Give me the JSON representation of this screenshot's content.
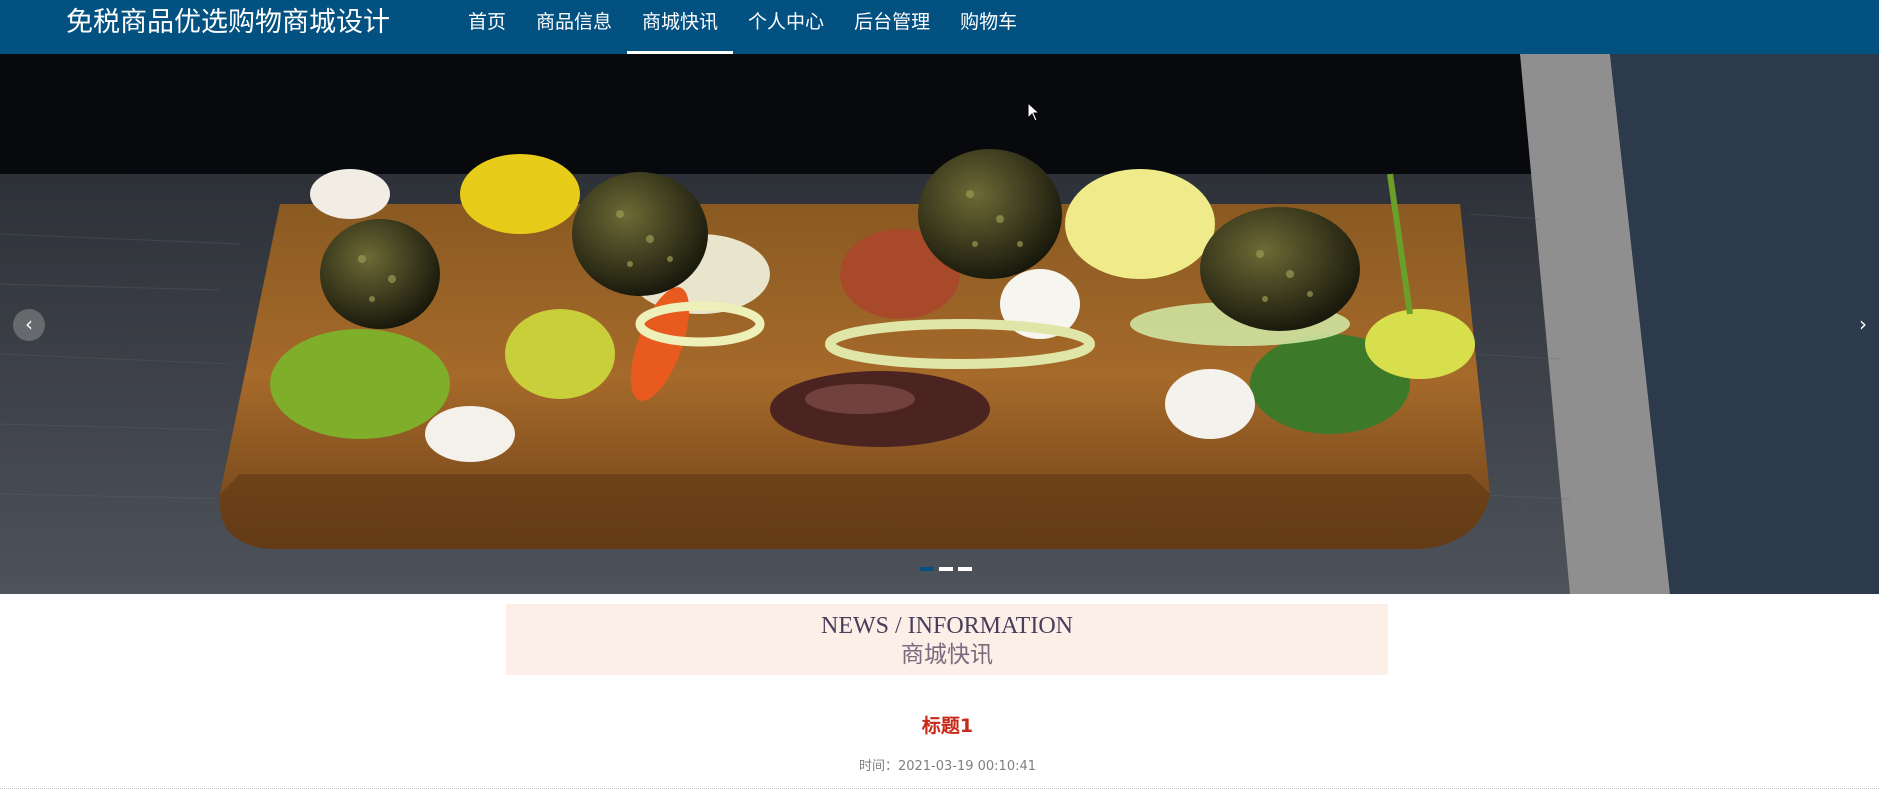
{
  "header": {
    "site_title": "免税商品优选购物商城设计",
    "nav": [
      {
        "label": "首页",
        "active": false
      },
      {
        "label": "商品信息",
        "active": false
      },
      {
        "label": "商城快讯",
        "active": true
      },
      {
        "label": "个人中心",
        "active": false
      },
      {
        "label": "后台管理",
        "active": false
      },
      {
        "label": "购物车",
        "active": false
      }
    ],
    "bg_color": "#035181"
  },
  "banner": {
    "prev_icon": "chevron-left-icon",
    "next_icon": "chevron-right-icon",
    "prev_glyph": "‹",
    "next_glyph": "›",
    "slide_count": 3,
    "active_slide": 1
  },
  "news": {
    "heading_en": "NEWS / INFORMATION",
    "heading_cn": "商城快讯",
    "heading_bg": "#fcefe8",
    "article": {
      "title": "标题1",
      "time": "时间：2021-03-19 00:10:41"
    }
  }
}
